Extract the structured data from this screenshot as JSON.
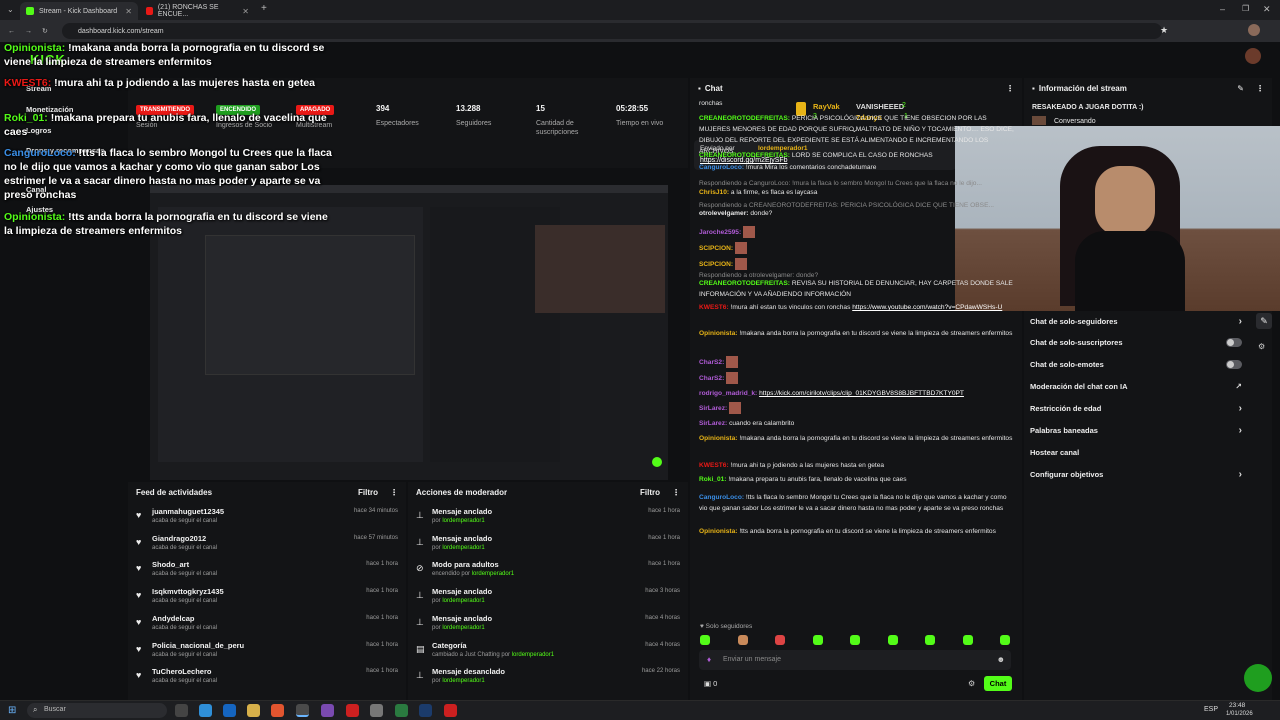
{
  "browser": {
    "tabs": [
      {
        "title": "Stream - Kick Dashboard"
      },
      {
        "title": "(21) RONCHAS SE ENCUE..."
      }
    ],
    "url": "dashboard.kick.com/stream"
  },
  "sidebar": {
    "items": [
      "Stream",
      "Monetización",
      "Logros",
      "Drops y recompensas",
      "Canal",
      "Ajustes"
    ]
  },
  "overlay_chat": [
    {
      "user": "Opinionista:",
      "text": "!makana anda borra la pornografia en tu discord se viene la limpieza de streamers enfermitos"
    },
    {
      "user": "KWEST6:",
      "text": "!mura ahi ta p jodiendo a las mujeres hasta en getea"
    },
    {
      "user": "Roki_01:",
      "text": "!makana prepara tu anubis fara, llenalo de vacelina que caes"
    },
    {
      "user": "CanguroLoco:",
      "text": "!tts la flaca lo sembro Mongol tu Crees que la flaca no le dijo que vamos a kachar y como vio que ganan sabor Los estrimer le va a sacar dinero hasta no mas poder y aparte se va preso ronchas"
    },
    {
      "user": "Opinionista:",
      "text": "!tts anda borra la pornografia en tu discord se viene la limpieza de streamers enfermitos"
    }
  ],
  "stats": [
    {
      "value": "TRANSMITIENDO",
      "label": "Sesión",
      "color": "#e91916"
    },
    {
      "value": "ENCENDIDO",
      "label": "Ingresos de Socio",
      "color": "#1f9e1f"
    },
    {
      "value": "APAGADO",
      "label": "Multistream",
      "color": "#e91916"
    },
    {
      "value": "394",
      "label": "Espectadores"
    },
    {
      "value": "13.288",
      "label": "Seguidores"
    },
    {
      "value": "15",
      "label": "Cantidad de suscripciones"
    },
    {
      "value": "05:28:55",
      "label": "Tiempo en vivo"
    }
  ],
  "activity_feed": {
    "title": "Feed de actividades",
    "filter": "Filtro",
    "items": [
      {
        "name": "juanmahuguet12345",
        "action": "acaba de seguir el canal",
        "time": "hace 34 minutos"
      },
      {
        "name": "Giandrago2012",
        "action": "acaba de seguir el canal",
        "time": "hace 57 minutos"
      },
      {
        "name": "Shodo_art",
        "action": "acaba de seguir el canal",
        "time": "hace 1 hora"
      },
      {
        "name": "Isqkmvttogkryz1435",
        "action": "acaba de seguir el canal",
        "time": "hace 1 hora"
      },
      {
        "name": "Andydelcap",
        "action": "acaba de seguir el canal",
        "time": "hace 1 hora"
      },
      {
        "name": "Policia_nacional_de_peru",
        "action": "acaba de seguir el canal",
        "time": "hace 1 hora"
      },
      {
        "name": "TuCheroLechero",
        "action": "acaba de seguir el canal",
        "time": "hace 1 hora"
      }
    ]
  },
  "mod_actions": {
    "title": "Acciones de moderador",
    "filter": "Filtro",
    "items": [
      {
        "name": "Mensaje anclado",
        "prefix": "por",
        "by": "lordemperador1",
        "time": "hace 1 hora"
      },
      {
        "name": "Mensaje anclado",
        "prefix": "por",
        "by": "lordemperador1",
        "time": "hace 1 hora"
      },
      {
        "name": "Modo para adultos",
        "prefix": "encendido por",
        "by": "lordemperador1",
        "time": "hace 1 hora"
      },
      {
        "name": "Mensaje anclado",
        "prefix": "por",
        "by": "lordemperador1",
        "time": "hace 3 horas"
      },
      {
        "name": "Mensaje anclado",
        "prefix": "por",
        "by": "lordemperador1",
        "time": "hace 4 horas"
      },
      {
        "name": "Categoría",
        "prefix": "cambiado a Just Chatting por",
        "by": "lordemperador1",
        "time": "hace 4 horas"
      },
      {
        "name": "Mensaje desanclado",
        "prefix": "por",
        "by": "lordemperador1",
        "time": "hace 22 horas"
      }
    ]
  },
  "chat": {
    "title": "Chat",
    "leaderboard": [
      {
        "name": "RayVak",
        "count": "3"
      },
      {
        "name": "VANISHEEED",
        "count": "2"
      },
      {
        "name": "7danys",
        "count": "1"
      }
    ],
    "pinned": {
      "label": "Enviado por",
      "user": "lordemperador1",
      "link": "https://discord.gg/m2EjySFb"
    },
    "messages": [
      {
        "user": "",
        "text": "ronchas"
      },
      {
        "user": "CREANEOROTODEFREITAS:",
        "text": "PERICIA PSICOLÓGICA DICE QUE TIENE OBSECION POR LAS MUJERES MENORES DE EDAD PORQUE SUFRIO MALTRATO DE NIÑO Y TOCAMIENTO.... ESO DICE, DIBUJO DEL REPORTE DEL EXPEDIENTE SE ESTÁ ALIMENTANDO E INCREMENTANDO LOS ARCHIVOS"
      },
      {
        "user": "CREANEOROTODEFREITAS:",
        "text": "LORD SE COMPLICA EL CASO DE RONCHAS"
      },
      {
        "user": "CanguroLoco:",
        "text": "!mura Mira los comentarios conchadetumare"
      },
      {
        "reply": "Respondiendo a CanguroLoco: !mura la flaca lo sembro Mongol tu Crees que la flaca no le dijo..."
      },
      {
        "user": "ChrisJ10:",
        "text": "a la firme, es flaca es laycasa"
      },
      {
        "reply": "Respondiendo a CREANEOROTODEFREITAS: PERICIA PSICOLÓGICA DICE QUE TIENE OBSE..."
      },
      {
        "user": "otrolevelgamer:",
        "text": "donde?"
      },
      {
        "user": "Jaroche2595:",
        "text": ""
      },
      {
        "user": "SCIPCION:",
        "text": ""
      },
      {
        "user": "SCIPCION:",
        "text": ""
      },
      {
        "reply": "Respondiendo a otrolevelgamer: donde?"
      },
      {
        "user": "CREANEOROTODEFREITAS:",
        "text": "REVISA SU HISTORIAL DE DENUNCIAR, HAY CARPETAS DONDE SALE INFORMACIÓN Y VA AÑADIENDO INFORMACIÓN"
      },
      {
        "user": "KWEST6:",
        "text": "!mura ahí estan tus vinculos con ronchas",
        "link": "https://www.youtube.com/watch?v=CPdawWSHs-U"
      },
      {
        "user": "Opinionista:",
        "text": "!makana anda borra la pornografia en tu discord se viene la limpieza de streamers enfermitos"
      },
      {
        "user": "CharS2:",
        "text": ""
      },
      {
        "user": "CharS2:",
        "text": ""
      },
      {
        "user": "rodrigo_madrid_k:",
        "text": "",
        "link": "https://kick.com/cirilotv/clips/clip_01KDYGBV8S8BJBFTTBD7KTY0PT"
      },
      {
        "user": "SirLarez:",
        "text": ""
      },
      {
        "user": "SirLarez:",
        "text": "cuando era calambrito"
      },
      {
        "user": "Opinionista:",
        "text": "!makana anda borra la pornografia en tu discord se viene la limpieza de streamers enfermitos"
      },
      {
        "user": "KWEST6:",
        "text": "!mura ahi ta p jodiendo a las mujeres hasta en getea"
      },
      {
        "user": "Roki_01:",
        "text": "!makana prepara tu anubis fara, llenalo de vacelina que caes"
      },
      {
        "user": "CanguroLoco:",
        "text": "!tts la flaca lo sembro Mongol tu Crees que la flaca no le dijo que vamos a kachar y como vio que ganan sabor Los estrimer le va a sacar dinero hasta no mas poder y aparte se va preso ronchas"
      },
      {
        "user": "Opinionista:",
        "text": "!tts anda borra la pornografia en tu discord se viene la limpieza de streamers enfermitos"
      }
    ],
    "followers_only": "Solo seguidores",
    "input_placeholder": "Enviar un mensaje",
    "points": "0",
    "send_label": "Chat"
  },
  "stream_info": {
    "title": "Información del stream",
    "stream_title": "RESAKEADO A JUGAR DOTITA :)",
    "category": "Conversando"
  },
  "chat_settings": [
    {
      "label": "Chat de solo-seguidores",
      "kind": "arrow"
    },
    {
      "label": "Chat de solo-suscriptores",
      "kind": "toggle"
    },
    {
      "label": "Chat de solo-emotes",
      "kind": "toggle"
    },
    {
      "label": "Moderación del chat con IA",
      "kind": "ext"
    },
    {
      "label": "Restricción de edad",
      "kind": "arrow"
    },
    {
      "label": "Palabras baneadas",
      "kind": "arrow"
    },
    {
      "label": "Hostear canal",
      "kind": "none"
    },
    {
      "label": "Configurar objetivos",
      "kind": "arrow"
    }
  ],
  "taskbar": {
    "search_placeholder": "Buscar",
    "lang": "ESP",
    "time": "23:48",
    "date": "1/01/2026"
  },
  "colors": {
    "accent": "#53fc18",
    "badge_red": "#e91916",
    "panel": "#131416"
  }
}
